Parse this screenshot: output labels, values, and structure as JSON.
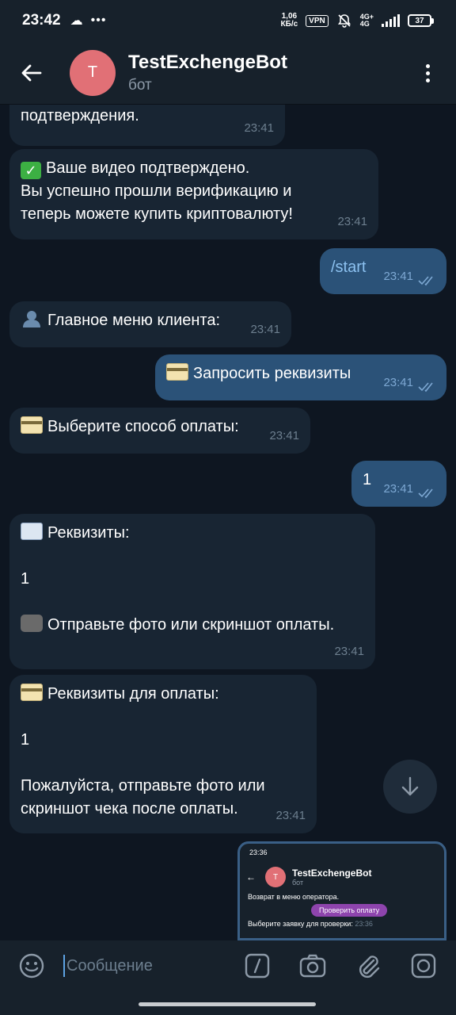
{
  "status": {
    "time": "23:42",
    "speed_top": "1,06",
    "speed_bottom": "КБ/с",
    "vpn": "VPN",
    "net_top": "4G+",
    "net_bottom": "4G",
    "battery": "37"
  },
  "header": {
    "avatar_letter": "T",
    "title": "TestExchengeBot",
    "subtitle": "бот"
  },
  "messages": [
    {
      "dir": "in",
      "text": "подтверждения.",
      "time": "23:41"
    },
    {
      "dir": "in",
      "emoji": "check",
      "text": "Ваше видео подтверждено.\nВы успешно прошли верификацию и\nтеперь можете купить криптовалюту!",
      "time": "23:41"
    },
    {
      "dir": "out",
      "text": "/start",
      "time": "23:41"
    },
    {
      "dir": "in",
      "emoji": "user",
      "text": "Главное меню клиента:",
      "time": "23:41"
    },
    {
      "dir": "out",
      "emoji": "card",
      "text": "Запросить реквизиты",
      "time": "23:41"
    },
    {
      "dir": "in",
      "emoji": "card",
      "text": "Выберите способ оплаты:",
      "time": "23:41"
    },
    {
      "dir": "out",
      "text": "1",
      "time": "23:41"
    },
    {
      "dir": "in",
      "emoji": "mail",
      "text": "Реквизиты:\n\n1\n\n",
      "extra_emoji": "camera",
      "extra": "Отправьте фото или скриншот оплаты.",
      "time": "23:41"
    },
    {
      "dir": "in",
      "emoji": "card",
      "text": "Реквизиты для оплаты:\n\n1\n\nПожалуйста, отправьте фото или\nскриншот чека после оплаты.",
      "time": "23:41"
    }
  ],
  "thumbnail": {
    "time": "23:36",
    "title": "TestExchengeBot",
    "subtitle": "бот",
    "row1": "Возврат в меню оператора.",
    "button": "Проверить оплату",
    "row2": "Выберите заявку для проверки:",
    "row2_time": "23:36"
  },
  "input": {
    "placeholder": "Сообщение"
  },
  "colors": {
    "incoming_bubble": "#182533",
    "outgoing_bubble": "#2b5278",
    "avatar": "#e17076",
    "accent": "#5ea3e4"
  }
}
